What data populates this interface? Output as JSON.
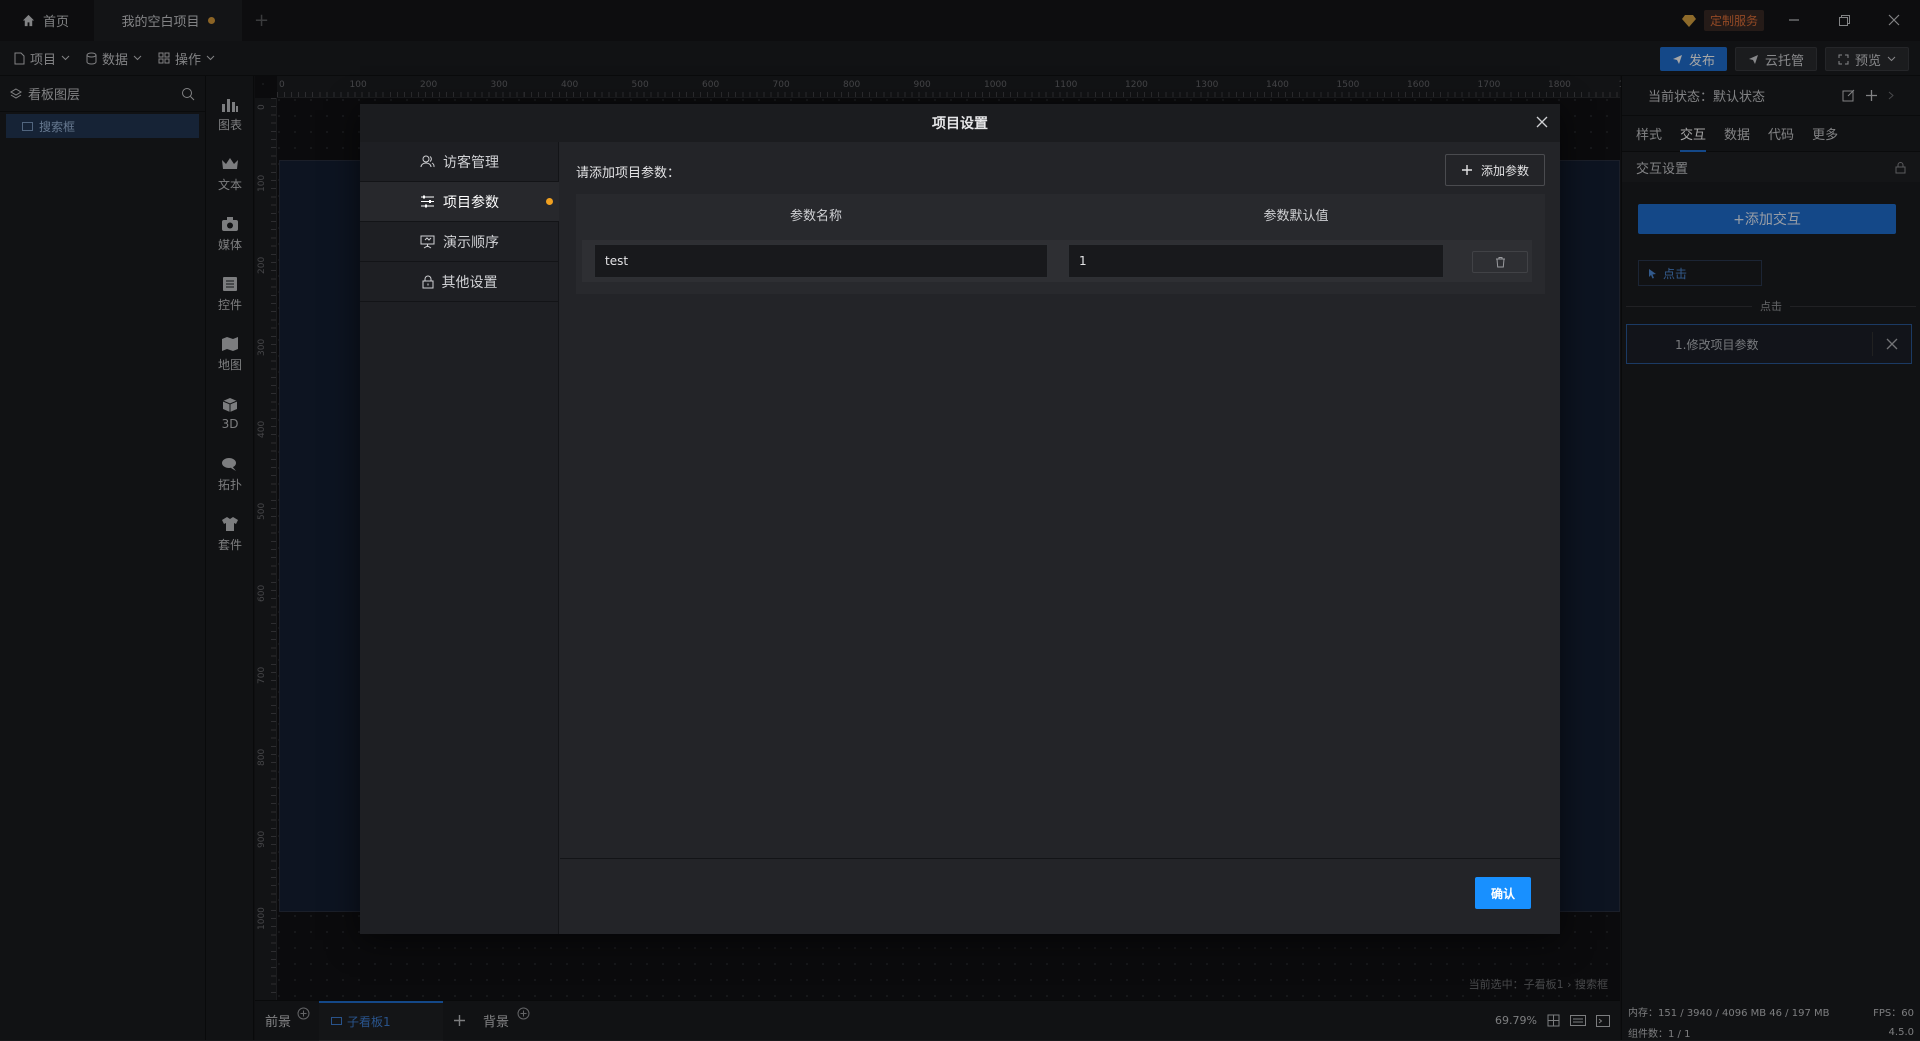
{
  "titlebar": {
    "tabs": [
      {
        "label": "首页"
      },
      {
        "label": "我的空白项目"
      }
    ],
    "new_tab": "+",
    "service_badge": "定制服务"
  },
  "toolbar": {
    "menus": [
      {
        "label": "项目"
      },
      {
        "label": "数据"
      },
      {
        "label": "操作"
      }
    ],
    "publish": "发布",
    "cloud_host": "云托管",
    "preview": "预览"
  },
  "layers": {
    "title": "看板图层",
    "items": [
      {
        "label": "搜索框"
      }
    ]
  },
  "rail": [
    {
      "label": "图表"
    },
    {
      "label": "文本"
    },
    {
      "label": "媒体"
    },
    {
      "label": "控件"
    },
    {
      "label": "地图"
    },
    {
      "label": "3D"
    },
    {
      "label": "拓扑"
    },
    {
      "label": "套件"
    }
  ],
  "ruler": {
    "top_ticks": [
      "0",
      "100",
      "200",
      "300",
      "400",
      "500",
      "600",
      "700",
      "800",
      "900",
      "1000",
      "1100",
      "1200",
      "1300",
      "1400",
      "1500",
      "1600",
      "1700",
      "1800",
      "1900"
    ],
    "left_ticks": [
      "0",
      "100",
      "200",
      "300",
      "400",
      "500",
      "600",
      "700",
      "800",
      "900",
      "1000"
    ]
  },
  "right": {
    "state_label": "当前状态：默认状态",
    "tabs": [
      {
        "label": "样式"
      },
      {
        "label": "交互"
      },
      {
        "label": "数据"
      },
      {
        "label": "代码"
      },
      {
        "label": "更多"
      }
    ],
    "section_title": "交互设置",
    "add_interaction": "+添加交互",
    "trigger_chip": "点击",
    "divider_label": "点击",
    "action_item": "1.修改项目参数"
  },
  "bottom": {
    "front": "前景",
    "sub_tab": "子看板1",
    "background": "背景",
    "selection_text": "当前选中：子看板1 › 搜索框",
    "zoom": "69.79%"
  },
  "status": {
    "memory": "内存：151 / 3940 / 4096 MB  46 / 197 MB",
    "fps": "FPS：60",
    "components": "组件数：1 / 1",
    "version": "4.5.0"
  },
  "modal": {
    "title": "项目设置",
    "nav": [
      {
        "label": "访客管理"
      },
      {
        "label": "项目参数"
      },
      {
        "label": "演示顺序"
      },
      {
        "label": "其他设置"
      }
    ],
    "prompt": "请添加项目参数：",
    "add_param": "添加参数",
    "col_name": "参数名称",
    "col_default": "参数默认值",
    "rows": [
      {
        "name": "test",
        "default": "1"
      }
    ],
    "confirm": "确认"
  },
  "colors": {
    "accent": "#1f6fd1",
    "confirm": "#1890ff",
    "dot": "#f0a020"
  }
}
